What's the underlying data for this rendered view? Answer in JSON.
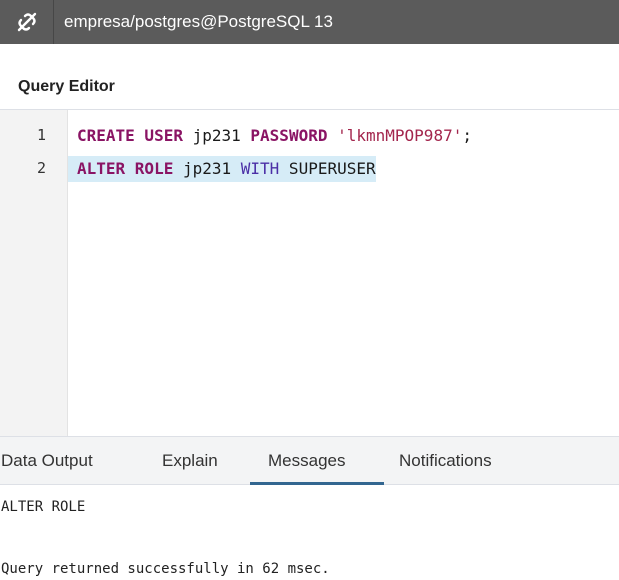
{
  "connection": {
    "icon": "connection-icon",
    "title": "empresa/postgres@PostgreSQL 13"
  },
  "query_editor": {
    "title": "Query Editor",
    "lines": [
      {
        "number": "1",
        "tokens": [
          {
            "text": "CREATE USER",
            "kind": "keyword"
          },
          {
            "text": " jp231 ",
            "kind": "ident"
          },
          {
            "text": "PASSWORD",
            "kind": "keyword"
          },
          {
            "text": " ",
            "kind": "ident"
          },
          {
            "text": "'lkmnMPOP987'",
            "kind": "string"
          },
          {
            "text": ";",
            "kind": "ident"
          }
        ]
      },
      {
        "number": "2",
        "tokens": [
          {
            "text": "ALTER ROLE",
            "kind": "keyword"
          },
          {
            "text": " jp231 ",
            "kind": "ident"
          },
          {
            "text": "WITH",
            "kind": "keyword2"
          },
          {
            "text": " SUPERUSER",
            "kind": "ident"
          }
        ]
      }
    ]
  },
  "output": {
    "tabs": [
      {
        "label": "Data Output",
        "active": false
      },
      {
        "label": "Explain",
        "active": false
      },
      {
        "label": "Messages",
        "active": true
      },
      {
        "label": "Notifications",
        "active": false
      }
    ],
    "messages": [
      "ALTER ROLE",
      "Query returned successfully in 62 msec."
    ]
  },
  "colors": {
    "connection_bar": "#5b5b5b",
    "active_line": "#d6ecf7",
    "keyword": "#8a1464",
    "keyword2": "#4b2fa6",
    "string": "#a3264d",
    "tab_accent": "#326690"
  }
}
